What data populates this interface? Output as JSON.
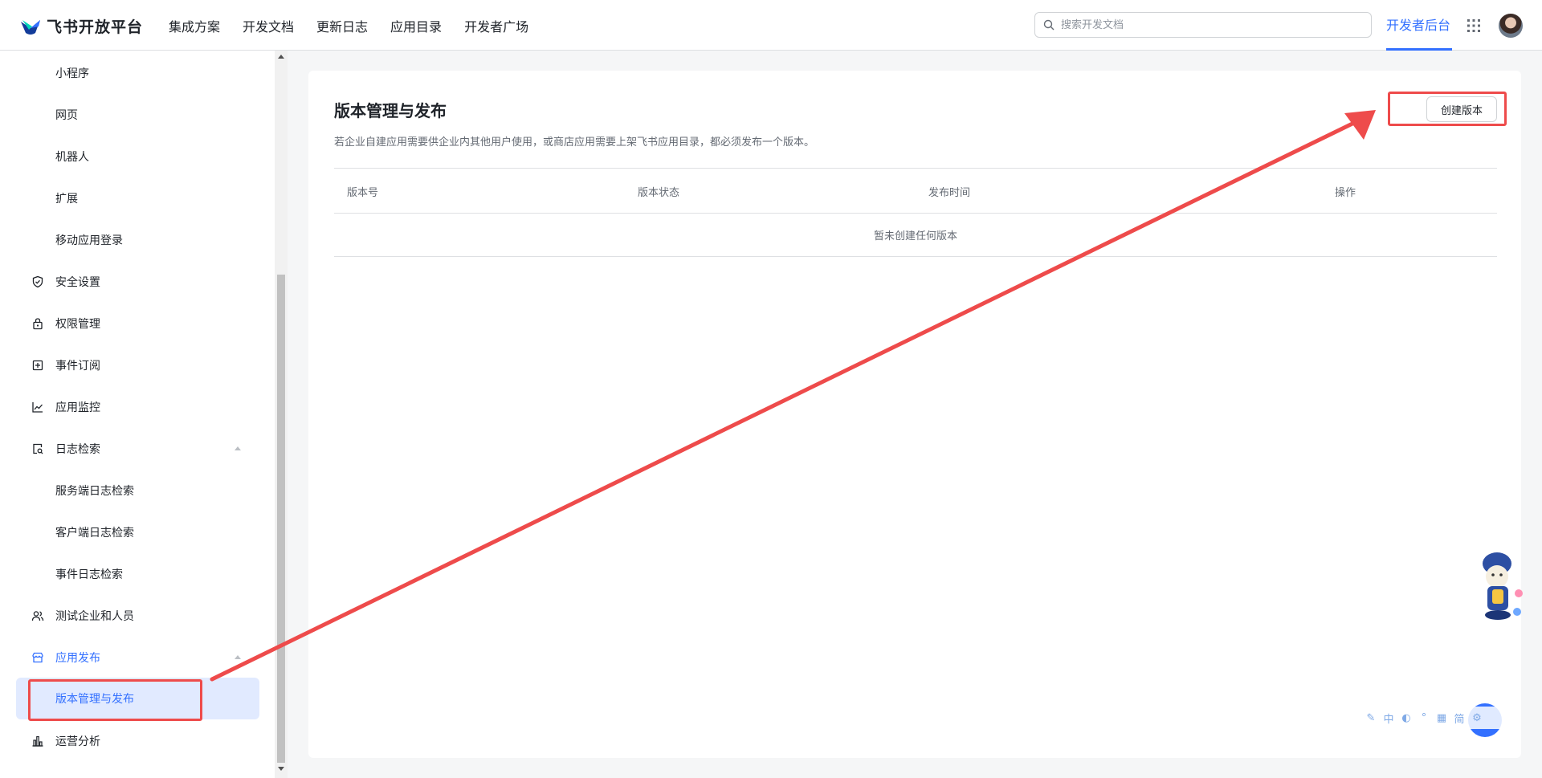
{
  "brand": {
    "name": "飞书开放平台"
  },
  "nav": {
    "links": [
      "集成方案",
      "开发文档",
      "更新日志",
      "应用目录",
      "开发者广场"
    ],
    "search_placeholder": "搜索开发文档",
    "dev_console": "开发者后台"
  },
  "sidebar": {
    "items": [
      {
        "label": "小程序"
      },
      {
        "label": "网页"
      },
      {
        "label": "机器人"
      },
      {
        "label": "扩展"
      },
      {
        "label": "移动应用登录"
      },
      {
        "label": "安全设置",
        "icon": "shield-icon"
      },
      {
        "label": "权限管理",
        "icon": "lock-icon"
      },
      {
        "label": "事件订阅",
        "icon": "event-icon"
      },
      {
        "label": "应用监控",
        "icon": "chart-line-icon"
      },
      {
        "label": "日志检索",
        "icon": "log-search-icon"
      },
      {
        "label": "服务端日志检索"
      },
      {
        "label": "客户端日志检索"
      },
      {
        "label": "事件日志检索"
      },
      {
        "label": "测试企业和人员",
        "icon": "users-icon"
      },
      {
        "label": "应用发布",
        "icon": "store-icon"
      },
      {
        "label": "版本管理与发布"
      },
      {
        "label": "运营分析",
        "icon": "bar-chart-icon"
      }
    ]
  },
  "main": {
    "title": "版本管理与发布",
    "description": "若企业自建应用需要供企业内其他用户使用，或商店应用需要上架飞书应用目录，都必须发布一个版本。",
    "create_button": "创建版本",
    "table": {
      "columns": [
        "版本号",
        "版本状态",
        "发布时间",
        "操作"
      ],
      "empty_text": "暂未创建任何版本"
    }
  },
  "ime": [
    "中",
    "◐",
    "°",
    "▦",
    "简",
    "⚙"
  ],
  "colors": {
    "accent": "#3370ff",
    "annotation": "#ee4b4b",
    "selected_bg": "#e1eaff"
  }
}
